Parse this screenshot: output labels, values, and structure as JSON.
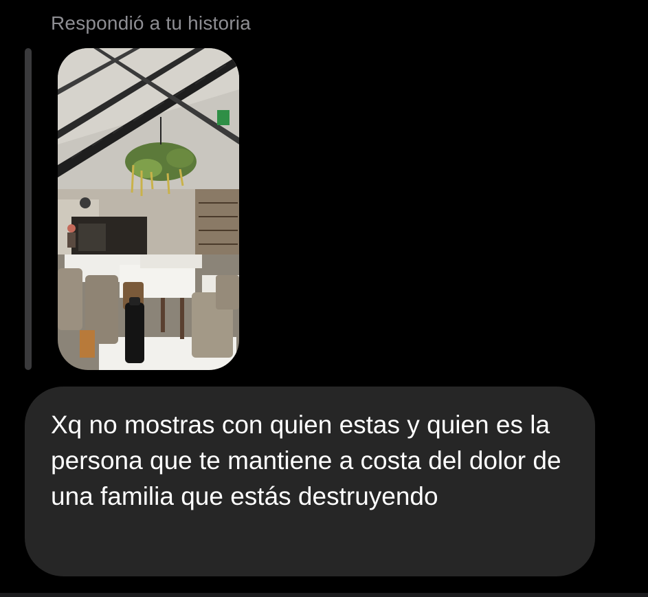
{
  "reply_context": {
    "label": "Respondió a tu historia"
  },
  "story_preview": {
    "description": "story-image-restaurant-interior"
  },
  "message": {
    "text": "Xq no mostras con quien estas y quien es la persona que te mantiene a costa del dolor de una familia que estás destruyendo"
  },
  "colors": {
    "background": "#000000",
    "bubble": "#262626",
    "label": "#8e8e93",
    "text": "#ffffff",
    "quote_bar": "#3a3a3c"
  }
}
